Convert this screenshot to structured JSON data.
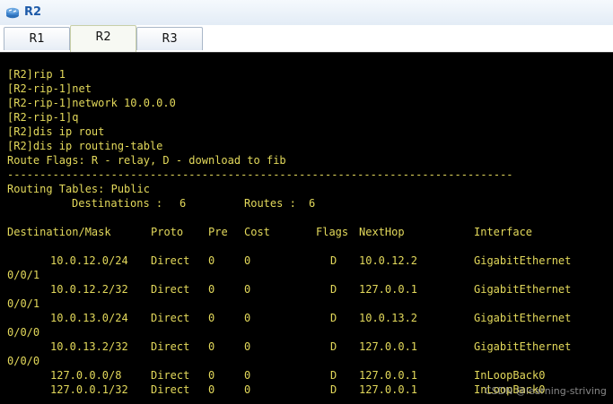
{
  "window": {
    "title": "R2",
    "title_icon": "router-icon"
  },
  "tabs": [
    {
      "label": "R1",
      "active": false
    },
    {
      "label": "R2",
      "active": true
    },
    {
      "label": "R3",
      "active": false
    }
  ],
  "terminal": {
    "text_color": "#e3d95b",
    "background": "#000000",
    "commands": [
      "[R2]rip 1",
      "[R2-rip-1]net",
      "[R2-rip-1]network 10.0.0.0",
      "[R2-rip-1]q",
      "[R2]dis ip rout",
      "[R2]dis ip routing-table"
    ],
    "route_flags": "Route Flags: R - relay, D - download to fib",
    "separator": "------------------------------------------------------------------------------",
    "routing_tables_label": "Routing Tables: Public",
    "summary": {
      "destinations_label": "Destinations :",
      "destinations_value": "6",
      "routes_label": "Routes :",
      "routes_value": "6"
    },
    "table_headers": {
      "destination": "Destination/Mask",
      "proto": "Proto",
      "pre": "Pre",
      "cost": "Cost",
      "flags": "Flags",
      "nexthop": "NextHop",
      "interface": "Interface"
    },
    "routes": [
      {
        "destination": "10.0.12.0/24",
        "proto": "Direct",
        "pre": "0",
        "cost": "0",
        "flags": "D",
        "nexthop": "10.0.12.2",
        "interface": "GigabitEthernet",
        "interface_cont": "0/0/1"
      },
      {
        "destination": "10.0.12.2/32",
        "proto": "Direct",
        "pre": "0",
        "cost": "0",
        "flags": "D",
        "nexthop": "127.0.0.1",
        "interface": "GigabitEthernet",
        "interface_cont": "0/0/1"
      },
      {
        "destination": "10.0.13.0/24",
        "proto": "Direct",
        "pre": "0",
        "cost": "0",
        "flags": "D",
        "nexthop": "10.0.13.2",
        "interface": "GigabitEthernet",
        "interface_cont": "0/0/0"
      },
      {
        "destination": "10.0.13.2/32",
        "proto": "Direct",
        "pre": "0",
        "cost": "0",
        "flags": "D",
        "nexthop": "127.0.0.1",
        "interface": "GigabitEthernet",
        "interface_cont": "0/0/0"
      },
      {
        "destination": "127.0.0.0/8",
        "proto": "Direct",
        "pre": "0",
        "cost": "0",
        "flags": "D",
        "nexthop": "127.0.0.1",
        "interface": "InLoopBack0",
        "interface_cont": ""
      },
      {
        "destination": "127.0.0.1/32",
        "proto": "Direct",
        "pre": "0",
        "cost": "0",
        "flags": "D",
        "nexthop": "127.0.0.1",
        "interface": "InLoopBack0",
        "interface_cont": ""
      }
    ]
  },
  "watermark": "CSDN @learning-striving"
}
